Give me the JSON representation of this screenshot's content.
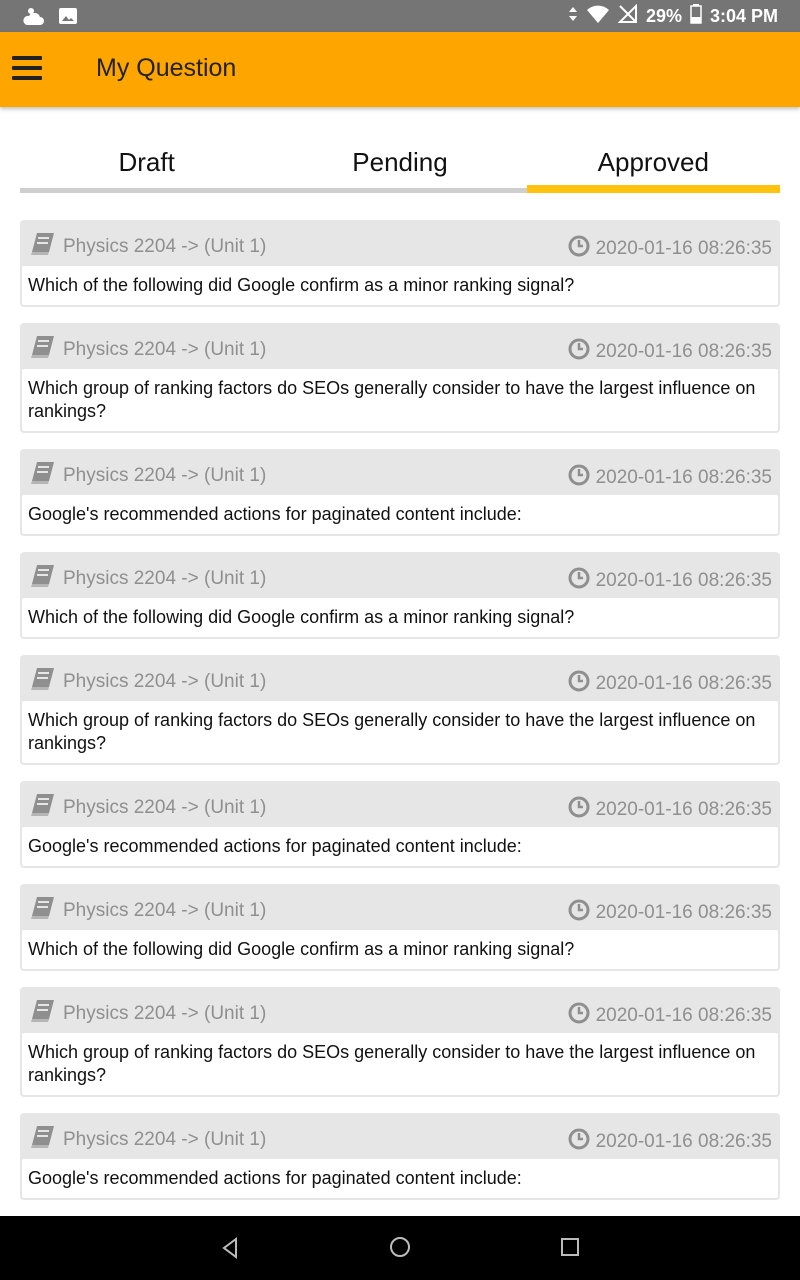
{
  "status_bar": {
    "battery": "29%",
    "time": "3:04 PM"
  },
  "app_bar": {
    "title": "My Question"
  },
  "tabs": [
    {
      "label": "Draft",
      "active": false
    },
    {
      "label": "Pending",
      "active": false
    },
    {
      "label": "Approved",
      "active": true
    }
  ],
  "questions": [
    {
      "subject": "Physics 2204 -> (Unit 1)",
      "date": "2020-01-16 08:26:35",
      "text": "Which of the following did Google confirm as a minor ranking signal?"
    },
    {
      "subject": "Physics 2204 -> (Unit 1)",
      "date": "2020-01-16 08:26:35",
      "text": "Which group of ranking factors do SEOs generally consider to have the largest influence on rankings?"
    },
    {
      "subject": "Physics 2204 -> (Unit 1)",
      "date": "2020-01-16 08:26:35",
      "text": "Google's recommended actions for paginated content include:"
    },
    {
      "subject": "Physics 2204 -> (Unit 1)",
      "date": "2020-01-16 08:26:35",
      "text": "Which of the following did Google confirm as a minor ranking signal?"
    },
    {
      "subject": "Physics 2204 -> (Unit 1)",
      "date": "2020-01-16 08:26:35",
      "text": "Which group of ranking factors do SEOs generally consider to have the largest influence on rankings?"
    },
    {
      "subject": "Physics 2204 -> (Unit 1)",
      "date": "2020-01-16 08:26:35",
      "text": "Google's recommended actions for paginated content include:"
    },
    {
      "subject": "Physics 2204 -> (Unit 1)",
      "date": "2020-01-16 08:26:35",
      "text": "Which of the following did Google confirm as a minor ranking signal?"
    },
    {
      "subject": "Physics 2204 -> (Unit 1)",
      "date": "2020-01-16 08:26:35",
      "text": "Which group of ranking factors do SEOs generally consider to have the largest influence on rankings?"
    },
    {
      "subject": "Physics 2204 -> (Unit 1)",
      "date": "2020-01-16 08:26:35",
      "text": "Google's recommended actions for paginated content include:"
    },
    {
      "subject": "Physics 2204 -> (Unit 1)",
      "date": "2020-01-16 08:26:35",
      "text": ""
    }
  ],
  "colors": {
    "app_bar": "#FFA500",
    "tab_indicator": "#FFC20E",
    "card_header": "#e6e6e6",
    "muted_text": "#8f8f8f"
  }
}
